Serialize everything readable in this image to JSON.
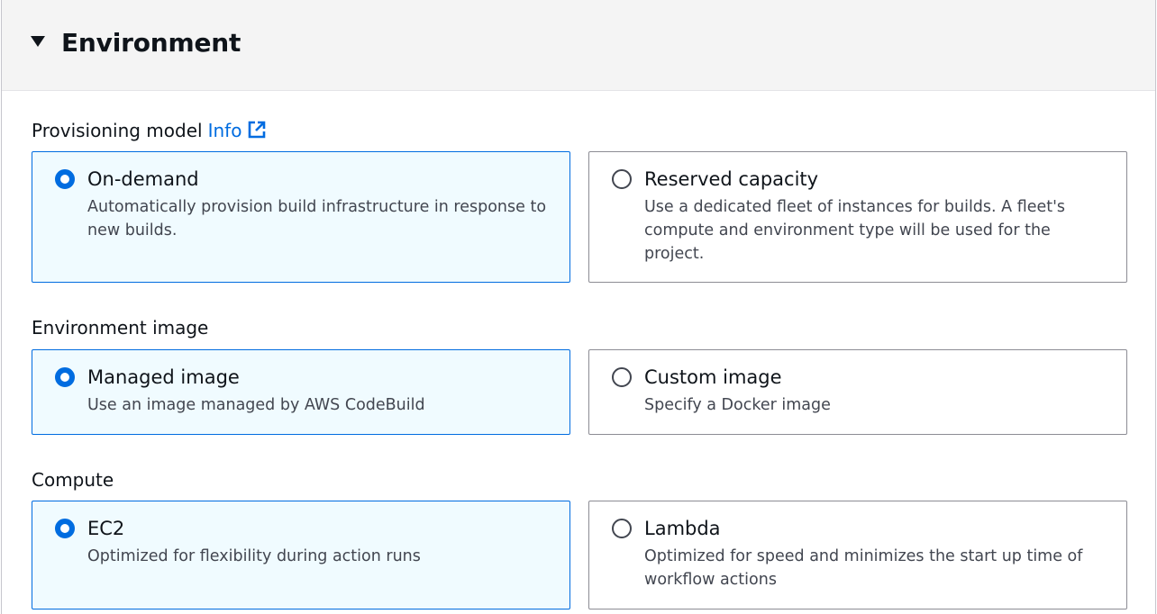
{
  "section": {
    "title": "Environment"
  },
  "provisioning": {
    "label": "Provisioning model",
    "info_link": "Info",
    "options": [
      {
        "title": "On-demand",
        "description": "Automatically provision build infrastructure in response to new builds.",
        "selected": true
      },
      {
        "title": "Reserved capacity",
        "description": "Use a dedicated fleet of instances for builds. A fleet's compute and environment type will be used for the project.",
        "selected": false
      }
    ]
  },
  "environment_image": {
    "label": "Environment image",
    "options": [
      {
        "title": "Managed image",
        "description": "Use an image managed by AWS CodeBuild",
        "selected": true
      },
      {
        "title": "Custom image",
        "description": "Specify a Docker image",
        "selected": false
      }
    ]
  },
  "compute": {
    "label": "Compute",
    "options": [
      {
        "title": "EC2",
        "description": "Optimized for flexibility during action runs",
        "selected": true
      },
      {
        "title": "Lambda",
        "description": "Optimized for speed and minimizes the start up time of workflow actions",
        "selected": false
      }
    ]
  },
  "colors": {
    "accent": "#006ce0",
    "selected_bg": "#f0fbff",
    "header_bg": "#f4f4f4"
  }
}
